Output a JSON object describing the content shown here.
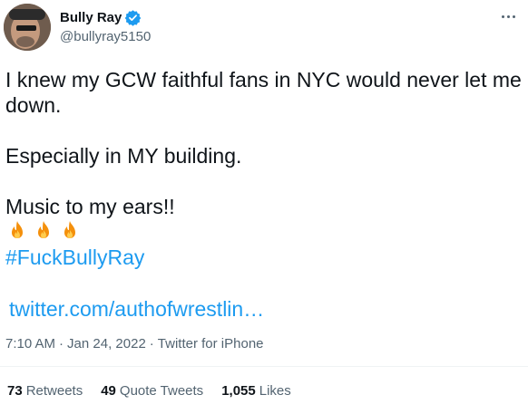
{
  "author": {
    "display_name": "Bully Ray",
    "handle": "@bullyray5150",
    "verified": true
  },
  "tweet": {
    "lines": [
      "I knew my GCW faithful fans in NYC would never let me",
      "down.",
      "Especially in MY building.",
      "Music to my ears!!"
    ],
    "emoji_count": 3,
    "hashtag": "#FuckBullyRay",
    "link": "twitter.com/authofwrestlin…"
  },
  "meta": {
    "time": "7:10 AM",
    "date": "Jan 24, 2022",
    "source": "Twitter for iPhone"
  },
  "stats": {
    "retweets_count": "73",
    "retweets_label": "Retweets",
    "quotes_count": "49",
    "quotes_label": "Quote Tweets",
    "likes_count": "1,055",
    "likes_label": "Likes"
  },
  "colors": {
    "link": "#1d9bf0",
    "secondary_text": "#536471",
    "primary_text": "#0f1419"
  }
}
